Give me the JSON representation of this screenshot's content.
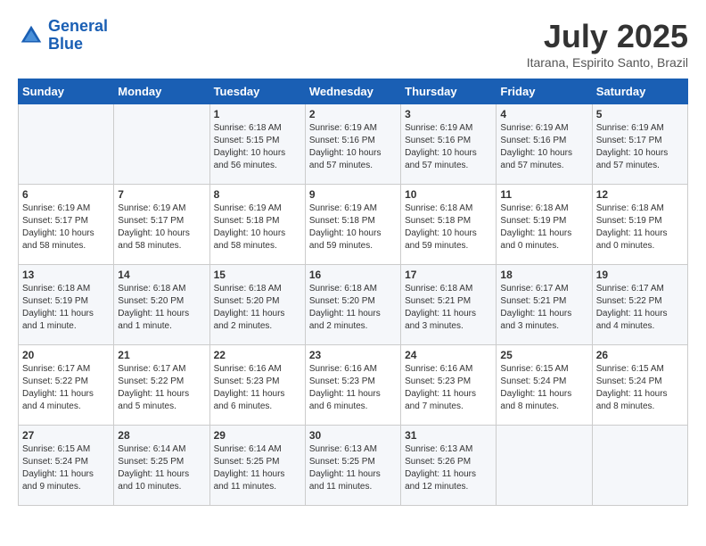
{
  "logo": {
    "line1": "General",
    "line2": "Blue"
  },
  "title": "July 2025",
  "subtitle": "Itarana, Espirito Santo, Brazil",
  "days_of_week": [
    "Sunday",
    "Monday",
    "Tuesday",
    "Wednesday",
    "Thursday",
    "Friday",
    "Saturday"
  ],
  "weeks": [
    [
      {
        "day": "",
        "info": ""
      },
      {
        "day": "",
        "info": ""
      },
      {
        "day": "1",
        "info": "Sunrise: 6:18 AM\nSunset: 5:15 PM\nDaylight: 10 hours and 56 minutes."
      },
      {
        "day": "2",
        "info": "Sunrise: 6:19 AM\nSunset: 5:16 PM\nDaylight: 10 hours and 57 minutes."
      },
      {
        "day": "3",
        "info": "Sunrise: 6:19 AM\nSunset: 5:16 PM\nDaylight: 10 hours and 57 minutes."
      },
      {
        "day": "4",
        "info": "Sunrise: 6:19 AM\nSunset: 5:16 PM\nDaylight: 10 hours and 57 minutes."
      },
      {
        "day": "5",
        "info": "Sunrise: 6:19 AM\nSunset: 5:17 PM\nDaylight: 10 hours and 57 minutes."
      }
    ],
    [
      {
        "day": "6",
        "info": "Sunrise: 6:19 AM\nSunset: 5:17 PM\nDaylight: 10 hours and 58 minutes."
      },
      {
        "day": "7",
        "info": "Sunrise: 6:19 AM\nSunset: 5:17 PM\nDaylight: 10 hours and 58 minutes."
      },
      {
        "day": "8",
        "info": "Sunrise: 6:19 AM\nSunset: 5:18 PM\nDaylight: 10 hours and 58 minutes."
      },
      {
        "day": "9",
        "info": "Sunrise: 6:19 AM\nSunset: 5:18 PM\nDaylight: 10 hours and 59 minutes."
      },
      {
        "day": "10",
        "info": "Sunrise: 6:18 AM\nSunset: 5:18 PM\nDaylight: 10 hours and 59 minutes."
      },
      {
        "day": "11",
        "info": "Sunrise: 6:18 AM\nSunset: 5:19 PM\nDaylight: 11 hours and 0 minutes."
      },
      {
        "day": "12",
        "info": "Sunrise: 6:18 AM\nSunset: 5:19 PM\nDaylight: 11 hours and 0 minutes."
      }
    ],
    [
      {
        "day": "13",
        "info": "Sunrise: 6:18 AM\nSunset: 5:19 PM\nDaylight: 11 hours and 1 minute."
      },
      {
        "day": "14",
        "info": "Sunrise: 6:18 AM\nSunset: 5:20 PM\nDaylight: 11 hours and 1 minute."
      },
      {
        "day": "15",
        "info": "Sunrise: 6:18 AM\nSunset: 5:20 PM\nDaylight: 11 hours and 2 minutes."
      },
      {
        "day": "16",
        "info": "Sunrise: 6:18 AM\nSunset: 5:20 PM\nDaylight: 11 hours and 2 minutes."
      },
      {
        "day": "17",
        "info": "Sunrise: 6:18 AM\nSunset: 5:21 PM\nDaylight: 11 hours and 3 minutes."
      },
      {
        "day": "18",
        "info": "Sunrise: 6:17 AM\nSunset: 5:21 PM\nDaylight: 11 hours and 3 minutes."
      },
      {
        "day": "19",
        "info": "Sunrise: 6:17 AM\nSunset: 5:22 PM\nDaylight: 11 hours and 4 minutes."
      }
    ],
    [
      {
        "day": "20",
        "info": "Sunrise: 6:17 AM\nSunset: 5:22 PM\nDaylight: 11 hours and 4 minutes."
      },
      {
        "day": "21",
        "info": "Sunrise: 6:17 AM\nSunset: 5:22 PM\nDaylight: 11 hours and 5 minutes."
      },
      {
        "day": "22",
        "info": "Sunrise: 6:16 AM\nSunset: 5:23 PM\nDaylight: 11 hours and 6 minutes."
      },
      {
        "day": "23",
        "info": "Sunrise: 6:16 AM\nSunset: 5:23 PM\nDaylight: 11 hours and 6 minutes."
      },
      {
        "day": "24",
        "info": "Sunrise: 6:16 AM\nSunset: 5:23 PM\nDaylight: 11 hours and 7 minutes."
      },
      {
        "day": "25",
        "info": "Sunrise: 6:15 AM\nSunset: 5:24 PM\nDaylight: 11 hours and 8 minutes."
      },
      {
        "day": "26",
        "info": "Sunrise: 6:15 AM\nSunset: 5:24 PM\nDaylight: 11 hours and 8 minutes."
      }
    ],
    [
      {
        "day": "27",
        "info": "Sunrise: 6:15 AM\nSunset: 5:24 PM\nDaylight: 11 hours and 9 minutes."
      },
      {
        "day": "28",
        "info": "Sunrise: 6:14 AM\nSunset: 5:25 PM\nDaylight: 11 hours and 10 minutes."
      },
      {
        "day": "29",
        "info": "Sunrise: 6:14 AM\nSunset: 5:25 PM\nDaylight: 11 hours and 11 minutes."
      },
      {
        "day": "30",
        "info": "Sunrise: 6:13 AM\nSunset: 5:25 PM\nDaylight: 11 hours and 11 minutes."
      },
      {
        "day": "31",
        "info": "Sunrise: 6:13 AM\nSunset: 5:26 PM\nDaylight: 11 hours and 12 minutes."
      },
      {
        "day": "",
        "info": ""
      },
      {
        "day": "",
        "info": ""
      }
    ]
  ]
}
